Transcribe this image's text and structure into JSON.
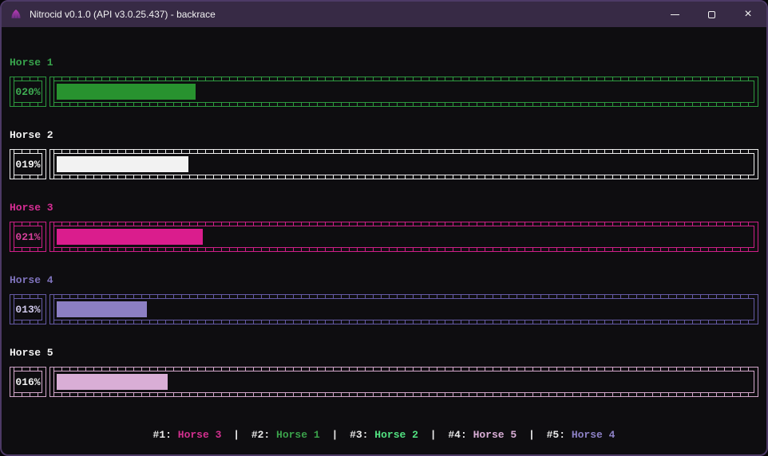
{
  "window": {
    "title": "Nitrocid v0.1.0 (API v3.0.25.437) - backrace",
    "titlebar_bg": "#372a45",
    "border_color": "#4d3a66",
    "content_bg": "#0e0d10",
    "controls": {
      "close_glyph": "×"
    }
  },
  "horses": [
    {
      "name": "Horse 1",
      "percent_label": "020%",
      "percent": 20,
      "label_color": "#38a34c",
      "border_color": "#2d9a3f",
      "fill_color": "#28922f",
      "value_color": "#3fae53"
    },
    {
      "name": "Horse 2",
      "percent_label": "019%",
      "percent": 19,
      "label_color": "#f2f2f2",
      "border_color": "#ededed",
      "fill_color": "#f2f2f2",
      "value_color": "#f2f2f2"
    },
    {
      "name": "Horse 3",
      "percent_label": "021%",
      "percent": 21,
      "label_color": "#d52d93",
      "border_color": "#ce1f87",
      "fill_color": "#da1d8d",
      "value_color": "#d6409a"
    },
    {
      "name": "Horse 4",
      "percent_label": "013%",
      "percent": 13,
      "label_color": "#7f73bd",
      "border_color": "#655aa5",
      "fill_color": "#8c7fc3",
      "value_color": "#cfc8ea"
    },
    {
      "name": "Horse 5",
      "percent_label": "016%",
      "percent": 16,
      "label_color": "#f2f2f2",
      "border_color": "#d2a6ca",
      "fill_color": "#d9aed6",
      "value_color": "#f2f2f2"
    }
  ],
  "standings": {
    "separator": "|",
    "items": [
      {
        "rank": "#1:",
        "name": "Horse 3",
        "color": "#d3308f"
      },
      {
        "rank": "#2:",
        "name": "Horse 1",
        "color": "#3ba24b"
      },
      {
        "rank": "#3:",
        "name": "Horse 2",
        "color": "#52e281"
      },
      {
        "rank": "#4:",
        "name": "Horse 5",
        "color": "#d9aed6"
      },
      {
        "rank": "#5:",
        "name": "Horse 4",
        "color": "#8d81c6"
      }
    ]
  }
}
